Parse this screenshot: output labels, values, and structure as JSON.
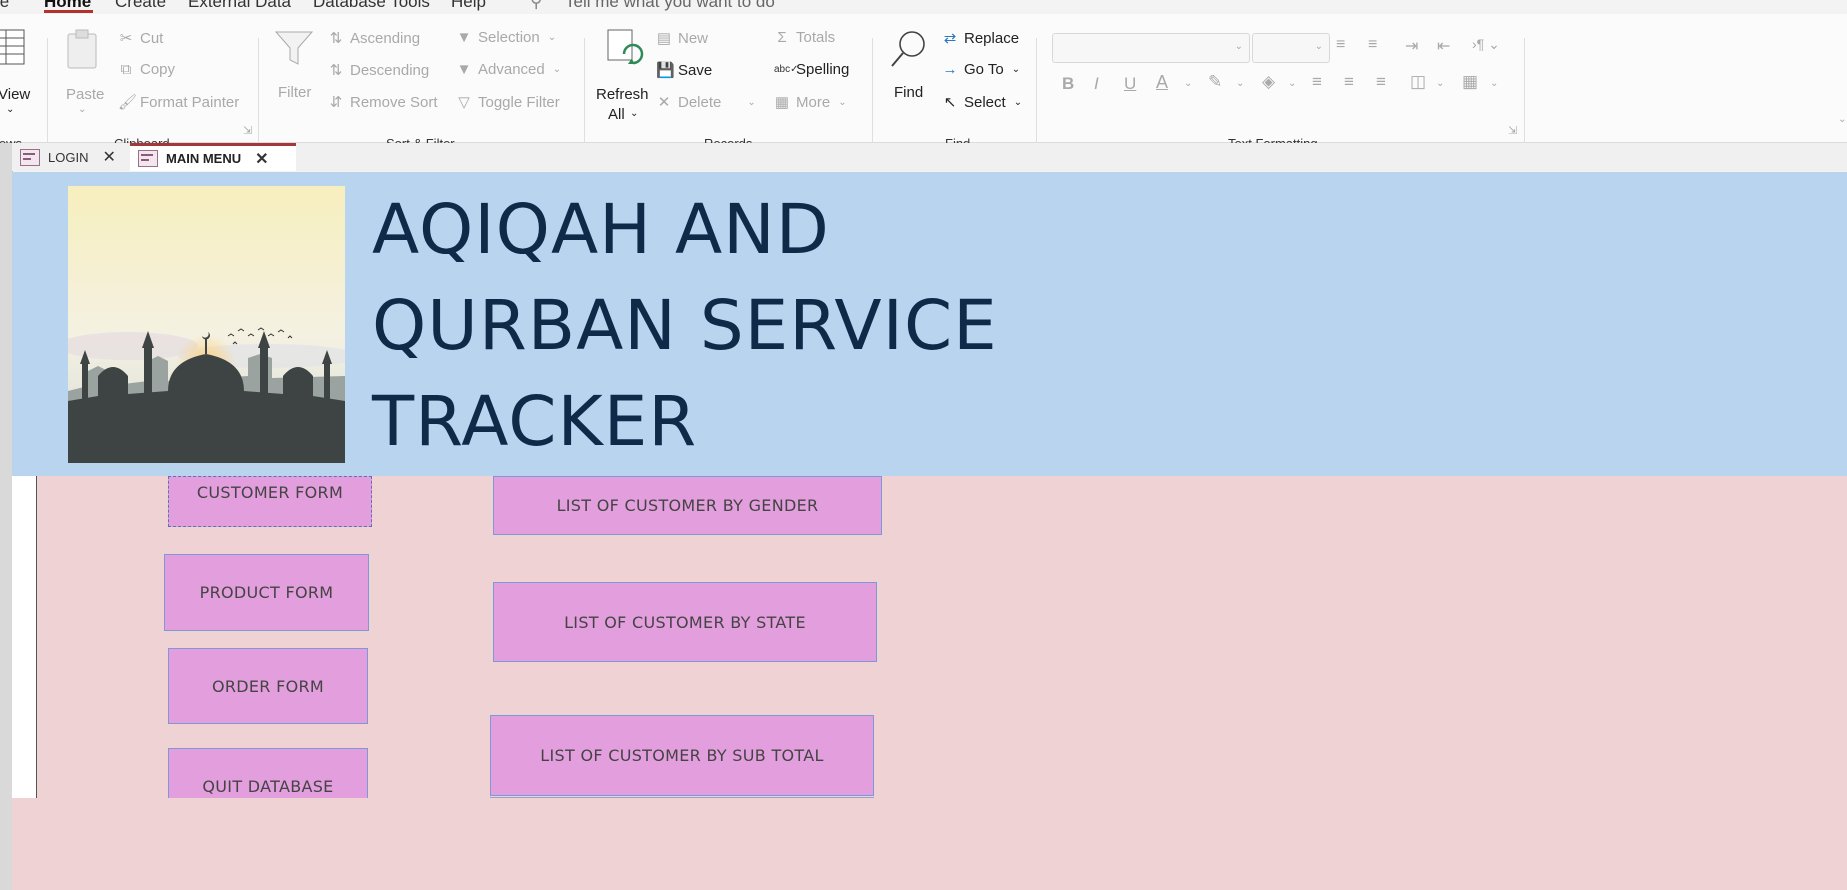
{
  "menu": {
    "items": [
      "File",
      "Home",
      "Create",
      "External Data",
      "Database Tools",
      "Help"
    ],
    "active": "Home",
    "search_placeholder": "Tell me what you want to do"
  },
  "ribbon": {
    "views": {
      "view": "View",
      "group": "Views"
    },
    "clipboard": {
      "paste": "Paste",
      "cut": "Cut",
      "copy": "Copy",
      "format_painter": "Format Painter",
      "group": "Clipboard"
    },
    "sort_filter": {
      "filter": "Filter",
      "ascending": "Ascending",
      "descending": "Descending",
      "remove_sort": "Remove Sort",
      "selection": "Selection",
      "advanced": "Advanced",
      "toggle_filter": "Toggle Filter",
      "group": "Sort & Filter"
    },
    "records": {
      "refresh": "Refresh",
      "refresh_all": "All",
      "new": "New",
      "save": "Save",
      "delete": "Delete",
      "totals": "Totals",
      "spelling": "Spelling",
      "more": "More",
      "group": "Records"
    },
    "find": {
      "find": "Find",
      "replace": "Replace",
      "goto": "Go To",
      "select": "Select",
      "group": "Find"
    },
    "text_formatting": {
      "bold": "B",
      "italic": "I",
      "underline": "U",
      "group": "Text Formatting"
    }
  },
  "tabs": [
    {
      "label": "LOGIN",
      "active": false
    },
    {
      "label": "MAIN MENU",
      "active": true
    }
  ],
  "form": {
    "title_lines": [
      "AQIQAH AND",
      "QURBAN SERVICE",
      "TRACKER"
    ],
    "buttons_left": [
      "CUSTOMER FORM",
      "PRODUCT FORM",
      "ORDER FORM",
      "QUIT DATABASE"
    ],
    "buttons_right": [
      "LIST OF CUSTOMER BY GENDER",
      "LIST OF CUSTOMER BY STATE",
      "LIST OF CUSTOMER BY SUB TOTAL"
    ]
  },
  "colors": {
    "header_bg": "#b8d4ef",
    "detail_bg": "#eed2d4",
    "button_bg": "#e39edd",
    "title_color": "#0f2a48",
    "tab_accent": "#a4373a"
  }
}
